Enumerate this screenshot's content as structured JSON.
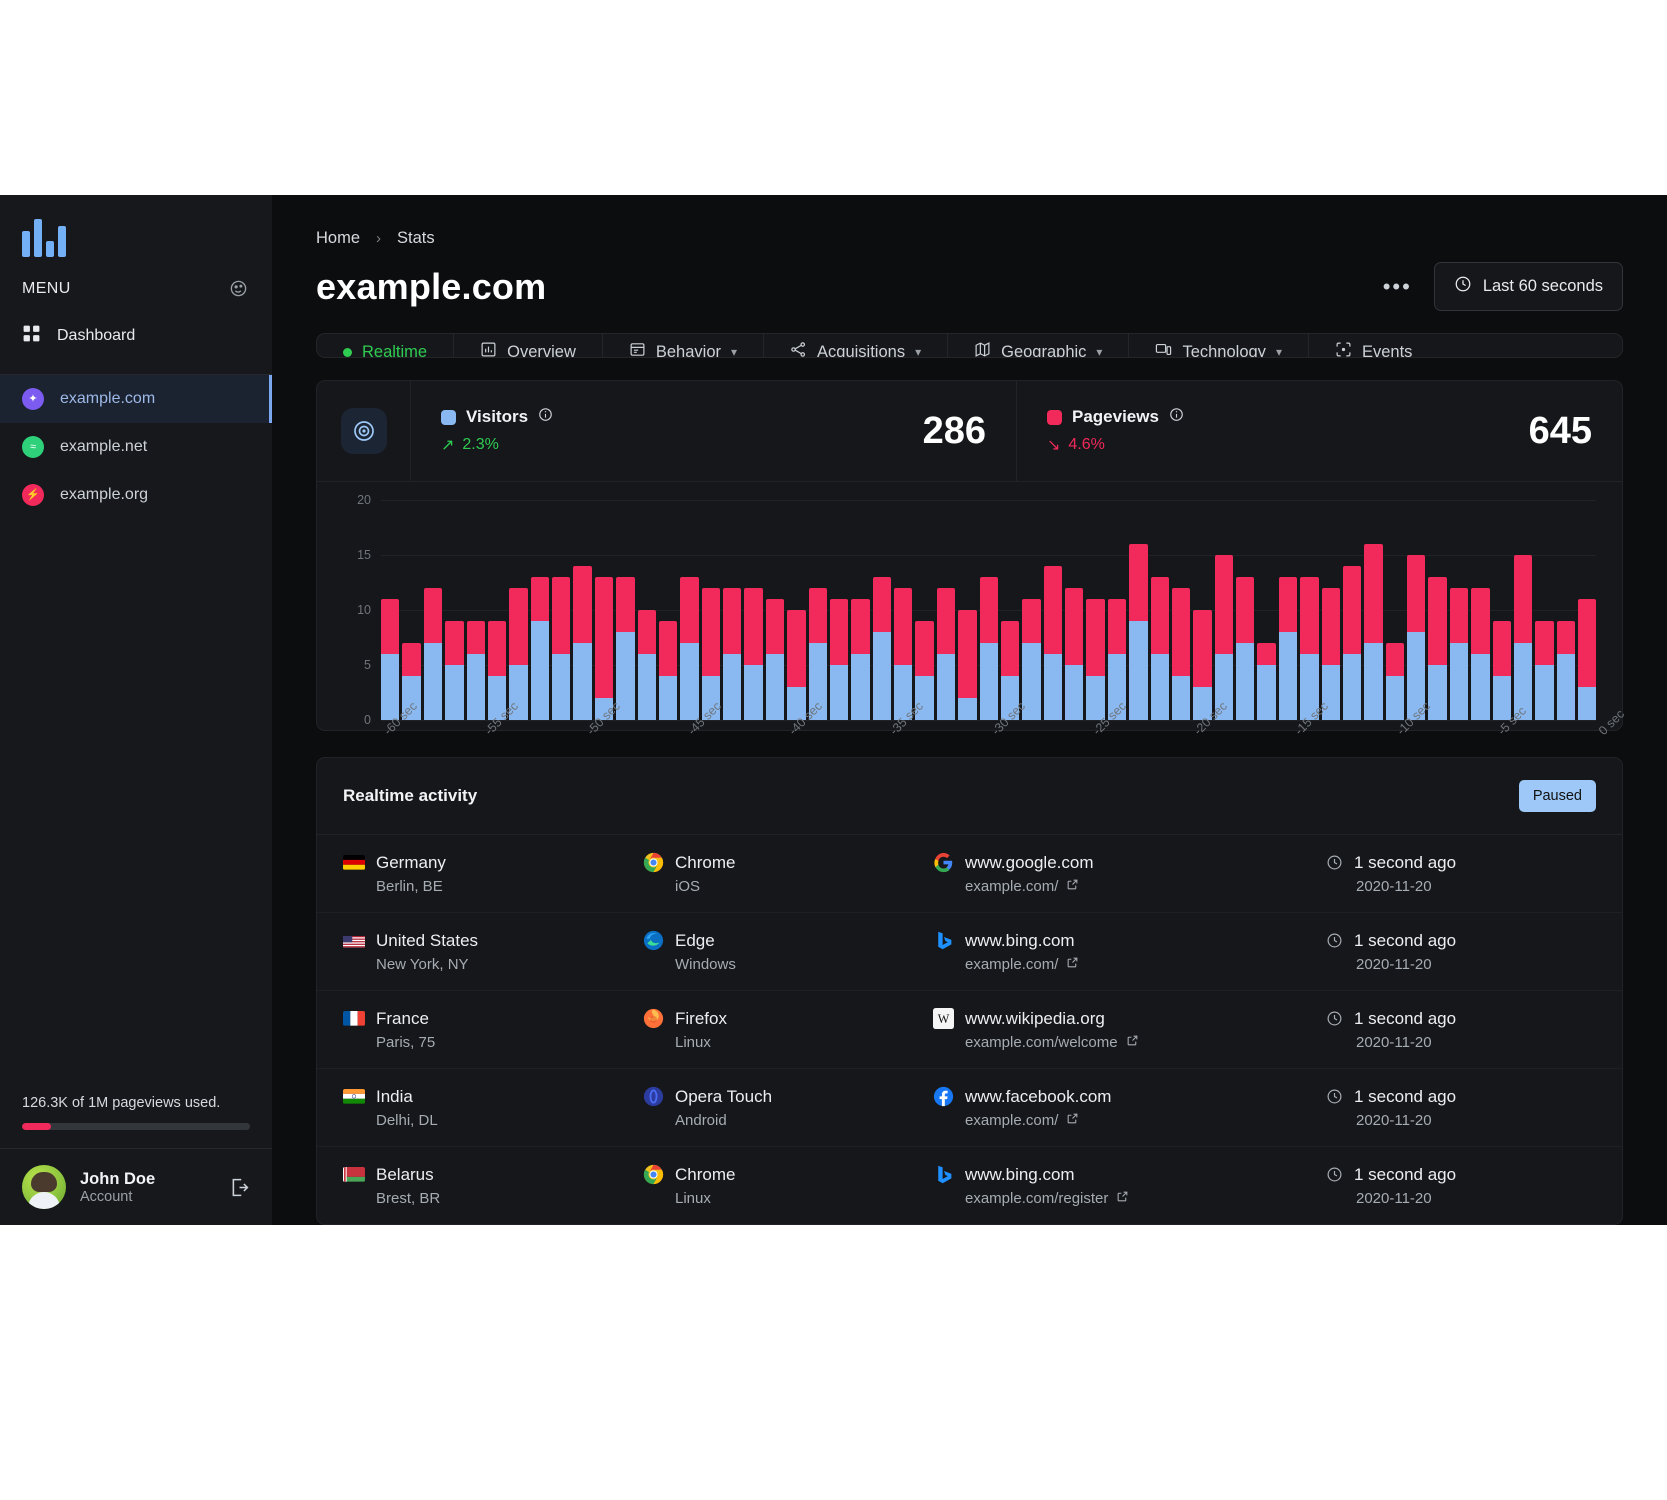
{
  "sidebar": {
    "logo_name": "bar-chart-logo",
    "menu_label": "MENU",
    "nav": [
      {
        "label": "Dashboard",
        "icon": "grid-icon"
      }
    ],
    "sites": [
      {
        "label": "example.com",
        "color": "#7c5cf0",
        "glyph": "✦",
        "active": true
      },
      {
        "label": "example.net",
        "color": "#2fd07a",
        "glyph": "≈",
        "active": false
      },
      {
        "label": "example.org",
        "color": "#f2295b",
        "glyph": "⚡",
        "active": false
      }
    ],
    "usage_text": "126.3K of 1M pageviews used.",
    "usage_percent": 12.63,
    "account": {
      "name": "John Doe",
      "subtitle": "Account",
      "logout_icon": "logout-icon"
    }
  },
  "header": {
    "breadcrumb": [
      "Home",
      "Stats"
    ],
    "breadcrumb_separator": "›",
    "title": "example.com",
    "more_label": "•••",
    "range_label": "Last 60 seconds",
    "range_icon": "clock-icon"
  },
  "tabs": [
    {
      "label": "Realtime",
      "icon": "green-dot-icon",
      "active": true,
      "caret": false
    },
    {
      "label": "Overview",
      "icon": "bar-chart-icon",
      "active": false,
      "caret": false
    },
    {
      "label": "Behavior",
      "icon": "window-icon",
      "active": false,
      "caret": true
    },
    {
      "label": "Acquisitions",
      "icon": "branch-icon",
      "active": false,
      "caret": true
    },
    {
      "label": "Geographic",
      "icon": "map-icon",
      "active": false,
      "caret": true
    },
    {
      "label": "Technology",
      "icon": "device-icon",
      "active": false,
      "caret": true
    },
    {
      "label": "Events",
      "icon": "target-icon",
      "active": false,
      "caret": false
    }
  ],
  "stats": {
    "panel_icon": "realtime-target-icon",
    "visitors": {
      "label": "Visitors",
      "color": "#8ab9f1",
      "delta": "2.3%",
      "delta_dir": "up",
      "delta_arrow": "↗",
      "value": "286",
      "info_icon": "info-icon"
    },
    "pageviews": {
      "label": "Pageviews",
      "color": "#f2295b",
      "delta": "4.6%",
      "delta_dir": "down",
      "delta_arrow": "↘",
      "value": "645",
      "info_icon": "info-icon"
    }
  },
  "chart_data": {
    "type": "bar",
    "title": "",
    "xlabel": "",
    "ylabel": "",
    "ylim": [
      0,
      20
    ],
    "yticks": [
      0,
      5,
      10,
      15,
      20
    ],
    "grid": true,
    "legend_position": "top",
    "stacked": true,
    "x_tick_labels": [
      "-60 sec",
      "-55 sec",
      "-50 sec",
      "-45 sec",
      "-40 sec",
      "-35 sec",
      "-30 sec",
      "-25 sec",
      "-20 sec",
      "-15 sec",
      "-10 sec",
      "-5 sec",
      "0 sec"
    ],
    "x_tick_every": 5,
    "series": [
      {
        "name": "Visitors",
        "color": "#8ab9f1",
        "values": [
          6,
          4,
          7,
          5,
          6,
          4,
          5,
          9,
          6,
          7,
          2,
          8,
          6,
          4,
          7,
          4,
          6,
          5,
          6,
          3,
          7,
          5,
          6,
          8,
          5,
          4,
          6,
          2,
          7,
          4,
          7,
          6,
          5,
          4,
          6,
          9,
          6,
          4,
          3,
          6,
          7,
          5,
          8,
          6,
          5,
          6,
          7,
          4,
          8,
          5,
          7,
          6,
          4,
          7,
          5,
          6,
          3
        ]
      },
      {
        "name": "Pageviews",
        "color": "#f2295b",
        "values": [
          5,
          3,
          5,
          4,
          3,
          5,
          7,
          4,
          7,
          7,
          11,
          5,
          4,
          5,
          6,
          8,
          6,
          7,
          5,
          7,
          5,
          6,
          5,
          5,
          7,
          5,
          6,
          8,
          6,
          5,
          4,
          8,
          7,
          7,
          5,
          7,
          7,
          8,
          7,
          9,
          6,
          2,
          5,
          7,
          7,
          8,
          9,
          3,
          7,
          8,
          5,
          6,
          5,
          8,
          4,
          3,
          8
        ]
      }
    ],
    "categories": [
      "-60",
      "-59",
      "-58",
      "-57",
      "-56",
      "-55",
      "-54",
      "-53",
      "-52",
      "-51",
      "-50",
      "-49",
      "-48",
      "-47",
      "-46",
      "-45",
      "-44",
      "-43",
      "-42",
      "-41",
      "-40",
      "-39",
      "-38",
      "-37",
      "-36",
      "-35",
      "-34",
      "-33",
      "-32",
      "-31",
      "-30",
      "-29",
      "-28",
      "-27",
      "-26",
      "-25",
      "-24",
      "-23",
      "-22",
      "-21",
      "-20",
      "-19",
      "-18",
      "-17",
      "-16",
      "-15",
      "-14",
      "-13",
      "-12",
      "-11",
      "-10",
      "-9",
      "-8",
      "-7",
      "-6",
      "-5",
      "-4"
    ]
  },
  "activity": {
    "title": "Realtime activity",
    "paused_label": "Paused",
    "rows": [
      {
        "country": "Germany",
        "city": "Berlin, BE",
        "flag": "de",
        "browser": "Chrome",
        "os": "iOS",
        "browser_icon": "chrome-icon",
        "referrer": "www.google.com",
        "page": "example.com/",
        "referrer_icon": "google-icon",
        "time": "1 second ago",
        "date": "2020-11-20"
      },
      {
        "country": "United States",
        "city": "New York, NY",
        "flag": "us",
        "browser": "Edge",
        "os": "Windows",
        "browser_icon": "edge-icon",
        "referrer": "www.bing.com",
        "page": "example.com/",
        "referrer_icon": "bing-icon",
        "time": "1 second ago",
        "date": "2020-11-20"
      },
      {
        "country": "France",
        "city": "Paris, 75",
        "flag": "fr",
        "browser": "Firefox",
        "os": "Linux",
        "browser_icon": "firefox-icon",
        "referrer": "www.wikipedia.org",
        "page": "example.com/welcome",
        "referrer_icon": "wikipedia-icon",
        "time": "1 second ago",
        "date": "2020-11-20"
      },
      {
        "country": "India",
        "city": "Delhi, DL",
        "flag": "in",
        "browser": "Opera Touch",
        "os": "Android",
        "browser_icon": "opera-icon",
        "referrer": "www.facebook.com",
        "page": "example.com/",
        "referrer_icon": "facebook-icon",
        "time": "1 second ago",
        "date": "2020-11-20"
      },
      {
        "country": "Belarus",
        "city": "Brest, BR",
        "flag": "by",
        "browser": "Chrome",
        "os": "Linux",
        "browser_icon": "chrome-icon",
        "referrer": "www.bing.com",
        "page": "example.com/register",
        "referrer_icon": "bing-icon",
        "time": "1 second ago",
        "date": "2020-11-20"
      }
    ]
  }
}
